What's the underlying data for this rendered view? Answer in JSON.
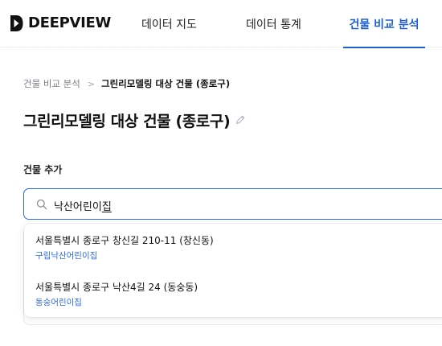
{
  "brand": {
    "name": "DEEPVIEW",
    "logo_icon": "deepview-logo-icon"
  },
  "nav": {
    "tabs": [
      {
        "label": "데이터 지도",
        "active": false
      },
      {
        "label": "데이터 통계",
        "active": false
      },
      {
        "label": "건물 비교 분석",
        "active": true
      }
    ]
  },
  "breadcrumb": {
    "parent": "건물 비교 분석",
    "separator": ">",
    "current": "그린리모델링 대상 건물 (종로구)"
  },
  "page": {
    "title": "그린리모델링 대상 건물 (종로구)",
    "edit_icon": "pencil-icon"
  },
  "section": {
    "label": "건물 추가"
  },
  "search": {
    "value_main": "낙산어린이",
    "value_composing": "집",
    "icon": "search-icon"
  },
  "suggestions": [
    {
      "address": "서울특별시 종로구 창신길 210-11 (창신동)",
      "name": "구립낙산어린이집"
    },
    {
      "address": "서울특별시 종로구 낙산4길 24 (동숭동)",
      "name": "동숭어린이집"
    }
  ],
  "colors": {
    "accent": "#1f5fd6",
    "link": "#2d6ae3",
    "text": "#111111",
    "muted": "#7a7f87"
  }
}
